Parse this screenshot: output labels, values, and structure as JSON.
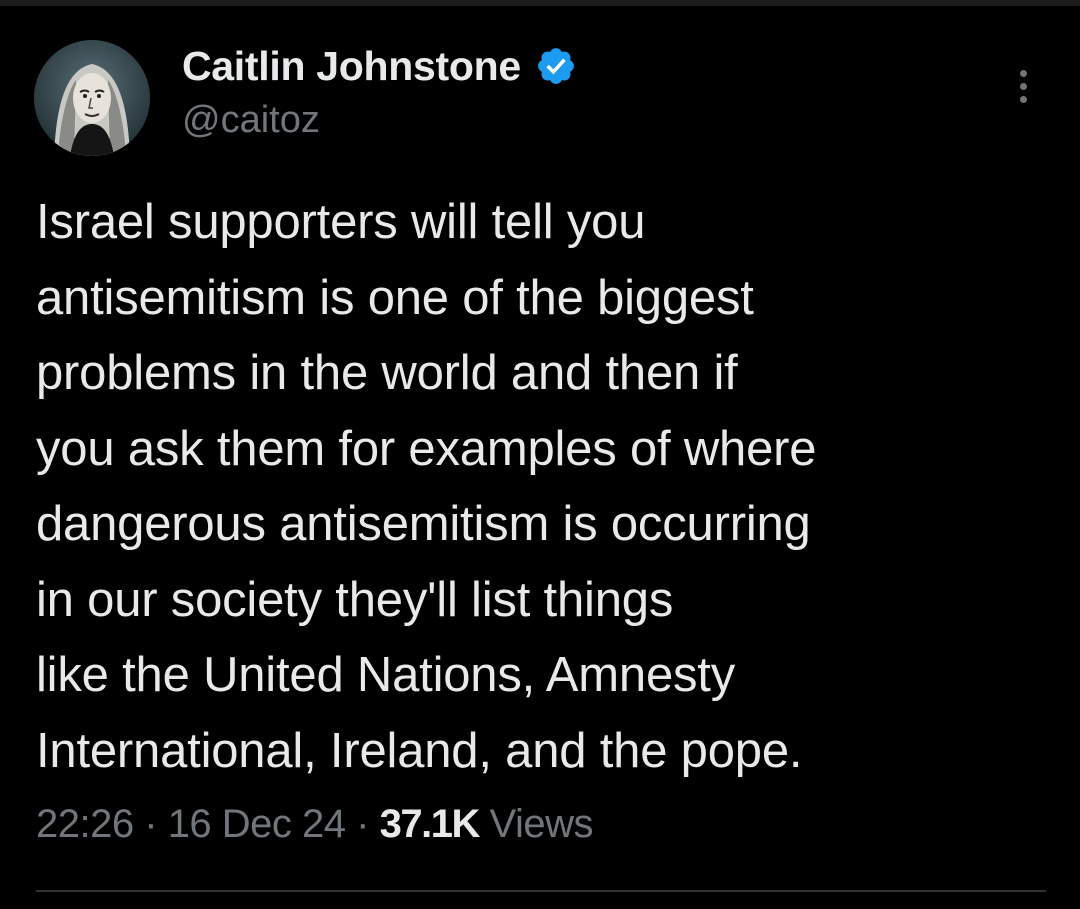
{
  "author": {
    "display_name": "Caitlin Johnstone",
    "handle": "@caitoz",
    "verified": true,
    "verified_color": "#1d9bf0"
  },
  "tweet": {
    "lines": [
      "Israel supporters will tell you",
      "antisemitism is one of the biggest",
      "problems in the world and then if",
      "you ask them for examples of where",
      "dangerous antisemitism is occurring",
      "in our society they'll list things",
      "like the United Nations, Amnesty",
      "International, Ireland, and the pope."
    ]
  },
  "meta": {
    "time": "22:26",
    "separator": "·",
    "date": "16 Dec 24",
    "views_count": "37.1K",
    "views_label": "Views"
  },
  "icons": {
    "verified": "verified-badge-icon",
    "more": "more-options-icon"
  },
  "colors": {
    "background": "#000000",
    "text_primary": "#e7e9ea",
    "text_secondary": "#71767b",
    "divider": "#2f3336"
  }
}
